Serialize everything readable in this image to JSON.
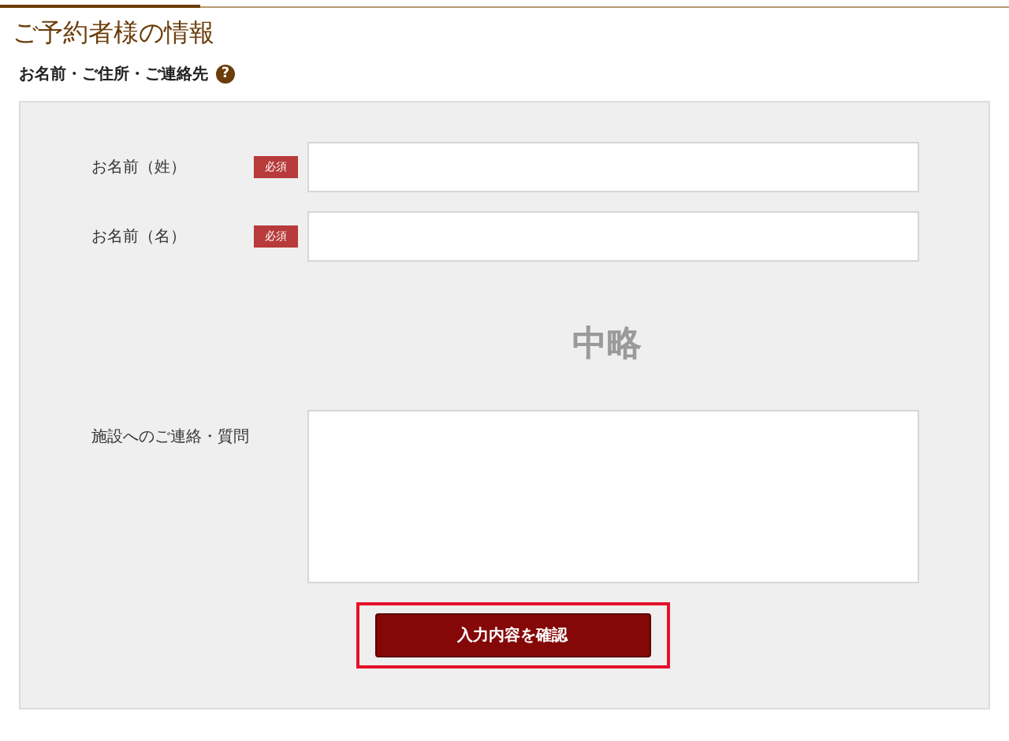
{
  "section_title": "ご予約者様の情報",
  "subtitle": {
    "text": "お名前・ご住所・ご連絡先",
    "help_icon": "?"
  },
  "fields": [
    {
      "label": "お名前（姓）",
      "kind": "text",
      "required": true,
      "required_label": "必須"
    },
    {
      "label": "お名前（名）",
      "kind": "text",
      "required": true,
      "required_label": "必須"
    },
    {
      "label": "施設へのご連絡・質問",
      "kind": "textarea",
      "required": false
    }
  ],
  "omission_note": "中略",
  "submit_button": {
    "label": "入力内容を確認",
    "highlighted": true
  }
}
